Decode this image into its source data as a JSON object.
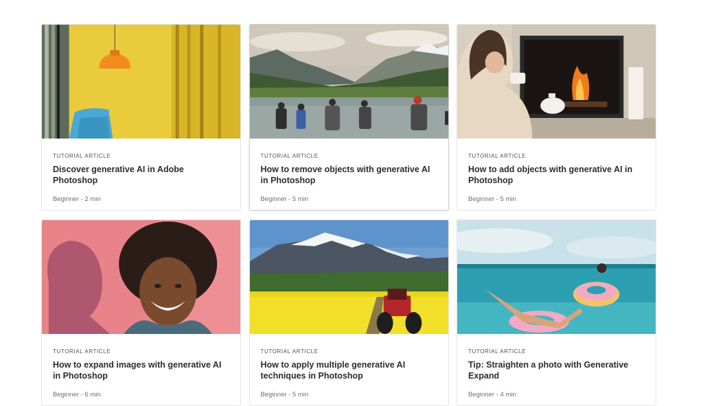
{
  "cards": [
    {
      "kind": "TUTORIAL ARTICLE",
      "title": "Discover generative AI in Adobe Photoshop",
      "meta": "Beginner - 2 min",
      "image": "yellow-room-lamp-chair"
    },
    {
      "kind": "TUTORIAL ARTICLE",
      "title": "How to remove objects with generative AI in Photoshop",
      "meta": "Beginner - 5 min",
      "image": "hikers-mountain-lake"
    },
    {
      "kind": "TUTORIAL ARTICLE",
      "title": "How to add objects with generative AI in Photoshop",
      "meta": "Beginner - 5 min",
      "image": "woman-fireplace-tea"
    },
    {
      "kind": "TUTORIAL ARTICLE",
      "title": "How to expand images with generative AI in Photoshop",
      "meta": "Beginner - 6 min",
      "image": "smiling-man-pink-wall"
    },
    {
      "kind": "TUTORIAL ARTICLE",
      "title": "How to apply multiple generative AI techniques in Photoshop",
      "meta": "Beginner - 5 min",
      "image": "tractor-flower-field-mountains"
    },
    {
      "kind": "TUTORIAL ARTICLE",
      "title": "Tip: Straighten a photo with Generative Expand",
      "meta": "Beginner - 4 min",
      "image": "women-floats-sea"
    }
  ]
}
